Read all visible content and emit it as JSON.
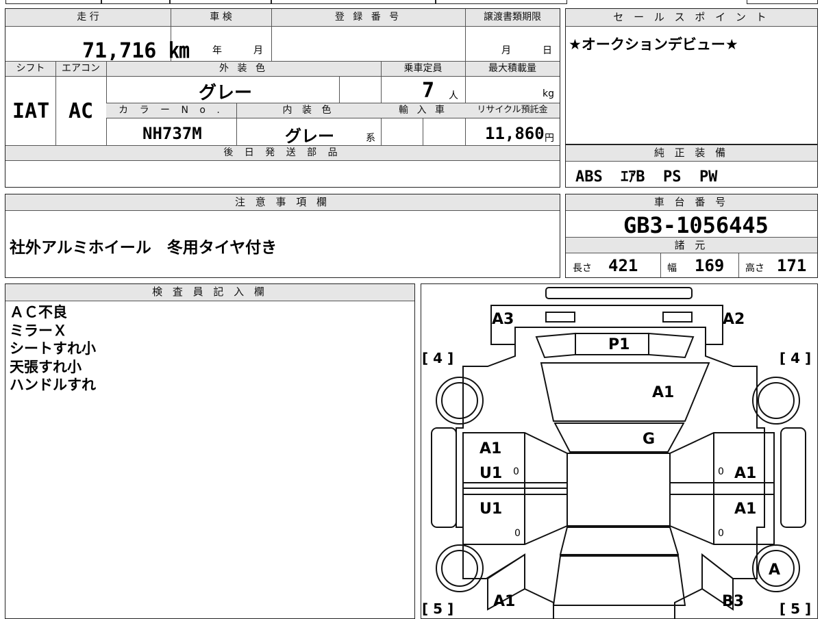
{
  "vehicle": {
    "mileage_label": "走 行",
    "mileage": "71,716 ㎞",
    "inspection_label": "車 検",
    "inspection_year_unit": "年",
    "inspection_month_unit": "月",
    "registration_label": "登 録 番 号",
    "transfer_deadline_label": "譲渡書類期限",
    "transfer_month_unit": "月",
    "transfer_day_unit": "日",
    "shift_label": "シフト",
    "shift": "IAT",
    "ac_label": "エアコン",
    "ac": "AC",
    "exterior_color_label": "外 装 色",
    "exterior_color": "グレー",
    "capacity_label": "乗車定員",
    "capacity": "7",
    "capacity_unit": "人",
    "max_load_label": "最大積載量",
    "max_load_unit": "kg",
    "color_no_label": "カ ラ ー N o .",
    "color_no": "NH737M",
    "interior_color_label": "内 装 色",
    "interior_color": "グレー",
    "interior_color_suffix": "系",
    "import_label": "輸 入 車",
    "recycle_label": "リサイクル預託金",
    "recycle_fee": "11,860",
    "recycle_unit": "円",
    "later_parts_label": "後 日 発 送 部 品"
  },
  "sales_point": {
    "label": "セ ー ル ス ポ イ ン ト",
    "text": "★オークションデビュー★"
  },
  "equipment": {
    "label": "純 正 装 備",
    "items": "ABS  ｴｱB  PS  PW"
  },
  "notes": {
    "label": "注 意 事 項 欄",
    "text": "社外アルミホイール　冬用タイヤ付き"
  },
  "chassis": {
    "label": "車 台 番 号",
    "number": "GB3-1056445",
    "specs_label": "諸 元",
    "length_label": "長さ",
    "length": "421",
    "width_label": "幅",
    "width": "169",
    "height_label": "高さ",
    "height": "171"
  },
  "inspector": {
    "label": "検 査 員 記 入 欄",
    "lines": [
      "ＡＣ不良",
      "ミラーＸ",
      "シートすれ小",
      "天張すれ小",
      "ハンドルすれ"
    ]
  },
  "diagram": {
    "marks": {
      "a3": "A3",
      "a2": "A2",
      "p1": "P1",
      "hood": "A1",
      "glass": "G",
      "left_front_door": "A1",
      "left_front_door_2": "U1",
      "right_front_door": "A1",
      "left_rear_door": "U1",
      "right_rear_door": "A1",
      "right_rear_wheel": "A",
      "left_rear_quarter": "A1",
      "right_rear_quarter": "B3"
    },
    "tire_front_left": "[ 4 ]",
    "tire_front_right": "[ 4 ]",
    "tire_rear_left": "[ 5 ]",
    "tire_rear_right": "[ 5 ]",
    "small_zero": "0"
  }
}
